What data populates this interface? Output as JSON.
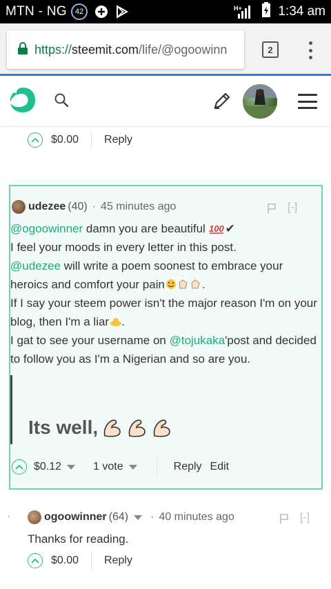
{
  "status_bar": {
    "carrier": "MTN - NG",
    "notification_count": "42",
    "network": "H+",
    "time": "1:34 am"
  },
  "browser": {
    "url_scheme": "https://",
    "url_host": "steemit.com",
    "url_path": "/life/@ogoowinn",
    "tab_count": "2"
  },
  "prev_comment_footer": {
    "payout": "$0.00",
    "reply": "Reply"
  },
  "highlighted_comment": {
    "author": "udezee",
    "reputation": "(40)",
    "separator": "·",
    "time_ago": "45 minutes ago",
    "collapse": "[-]",
    "body": {
      "line1_mention": "@ogoowinner",
      "line1_text": " damn you are beautiful ",
      "line2": "I feel your moods in every letter in this post.",
      "line3_mention": "@udezee",
      "line3_text": " will write a poem soonest to embrace your heroics and comfort your pain",
      "line4": "If I say your steem power isn't the major reason I'm on your blog, then I'm a liar",
      "line5_text_a": "I gat to see your username on ",
      "line5_mention": "@tojukaka",
      "line5_text_b": "'post and decided to follow you as I'm a Nigerian and so are you."
    },
    "image_text": "Its well,",
    "payout": "$0.12",
    "votes": "1 vote",
    "reply": "Reply",
    "edit": "Edit"
  },
  "reply_comment": {
    "bullet": "·",
    "author": "ogoowinner",
    "reputation": "(64)",
    "separator": "·",
    "time_ago": "40 minutes ago",
    "collapse": "[-]",
    "body": "Thanks for reading.",
    "payout": "$0.00",
    "reply": "Reply"
  },
  "colors": {
    "accent": "#1fbf8f",
    "highlight_bg": "#f2fbf7",
    "highlight_border": "#6fd3aa",
    "progress": "#2e7bd6"
  }
}
